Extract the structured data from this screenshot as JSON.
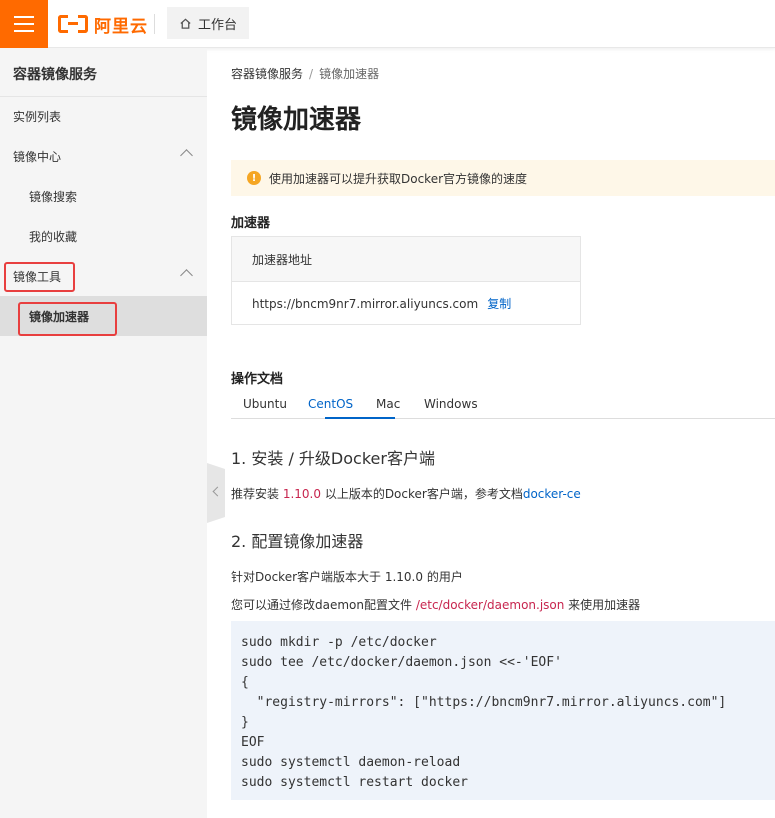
{
  "topbar": {
    "brand": "阿里云",
    "workbench": "工作台"
  },
  "sidebar": {
    "title": "容器镜像服务",
    "items": [
      {
        "label": "实例列表"
      },
      {
        "label": "镜像中心"
      },
      {
        "label": "镜像搜索"
      },
      {
        "label": "我的收藏"
      },
      {
        "label": "镜像工具"
      },
      {
        "label": "镜像加速器"
      }
    ]
  },
  "breadcrumb": {
    "root": "容器镜像服务",
    "separator": "/",
    "current": "镜像加速器"
  },
  "page_title": "镜像加速器",
  "alert": {
    "icon": "!",
    "text": "使用加速器可以提升获取Docker官方镜像的速度"
  },
  "accelerator": {
    "title": "加速器",
    "header": "加速器地址",
    "address": "https://bncm9nr7.mirror.aliyuncs.com",
    "copy": "复制"
  },
  "docs": {
    "title": "操作文档",
    "tabs": [
      "Ubuntu",
      "CentOS",
      "Mac",
      "Windows"
    ],
    "active_tab": "CentOS",
    "step1": {
      "heading": "1. 安装 / 升级Docker客户端",
      "text_a": "推荐安装 ",
      "version": "1.10.0",
      "text_b": " 以上版本的Docker客户端，参考文档",
      "link": "docker-ce"
    },
    "step2": {
      "heading": "2. 配置镜像加速器",
      "line1": "针对Docker客户端版本大于 1.10.0 的用户",
      "line2_a": "您可以通过修改daemon配置文件 ",
      "path": "/etc/docker/daemon.json",
      "line2_b": " 来使用加速器",
      "code": "sudo mkdir -p /etc/docker\nsudo tee /etc/docker/daemon.json <<-'EOF'\n{\n  \"registry-mirrors\": [\"https://bncm9nr7.mirror.aliyuncs.com\"]\n}\nEOF\nsudo systemctl daemon-reload\nsudo systemctl restart docker"
    }
  },
  "colors": {
    "brand": "#ff6a00",
    "link": "#0064c8",
    "highlight_box": "#e83f3f",
    "code_red": "#c7254e"
  }
}
